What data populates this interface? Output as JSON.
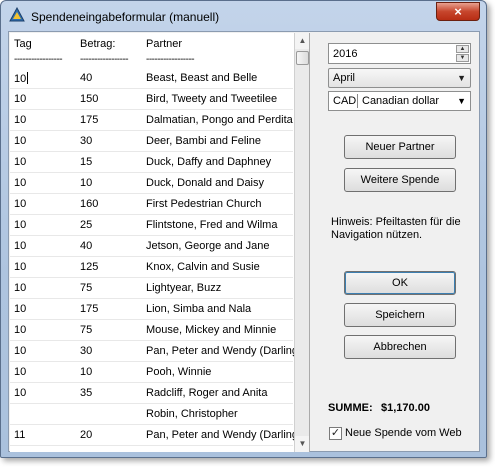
{
  "window": {
    "title": "Spendeneingabeformular (manuell)",
    "close_glyph": "×"
  },
  "list": {
    "columns": [
      "Tag",
      "Betrag:",
      "Partner"
    ],
    "dashes": [
      "-----------------",
      "-----------------",
      "-----------------"
    ],
    "rows": [
      {
        "tag": "10",
        "betrag": "40",
        "partner": "Beast, Beast and Belle"
      },
      {
        "tag": "10",
        "betrag": "150",
        "partner": "Bird, Tweety and Tweetilee"
      },
      {
        "tag": "10",
        "betrag": "175",
        "partner": "Dalmatian, Pongo and Perdita"
      },
      {
        "tag": "10",
        "betrag": "30",
        "partner": "Deer, Bambi and Feline"
      },
      {
        "tag": "10",
        "betrag": "15",
        "partner": "Duck, Daffy and Daphney"
      },
      {
        "tag": "10",
        "betrag": "10",
        "partner": "Duck, Donald and Daisy"
      },
      {
        "tag": "10",
        "betrag": "160",
        "partner": "First Pedestrian Church"
      },
      {
        "tag": "10",
        "betrag": "25",
        "partner": "Flintstone, Fred and Wilma"
      },
      {
        "tag": "10",
        "betrag": "40",
        "partner": "Jetson, George and Jane"
      },
      {
        "tag": "10",
        "betrag": "125",
        "partner": "Knox, Calvin and Susie"
      },
      {
        "tag": "10",
        "betrag": "75",
        "partner": "Lightyear, Buzz"
      },
      {
        "tag": "10",
        "betrag": "175",
        "partner": "Lion, Simba and Nala"
      },
      {
        "tag": "10",
        "betrag": "75",
        "partner": "Mouse, Mickey and Minnie"
      },
      {
        "tag": "10",
        "betrag": "30",
        "partner": "Pan, Peter and Wendy (Darling)"
      },
      {
        "tag": "10",
        "betrag": "10",
        "partner": "Pooh, Winnie"
      },
      {
        "tag": "10",
        "betrag": "35",
        "partner": "Radcliff, Roger and Anita"
      },
      {
        "tag": "",
        "betrag": "",
        "partner": "Robin, Christopher"
      },
      {
        "tag": "11",
        "betrag": "20",
        "partner": "Pan, Peter and Wendy (Darling)"
      }
    ]
  },
  "year": "2016",
  "month": "April",
  "currency": {
    "code": "CAD",
    "name": "Canadian dollar"
  },
  "buttons": {
    "new_partner": "Neuer Partner",
    "more_donation": "Weitere Spende",
    "ok": "OK",
    "save": "Speichern",
    "cancel": "Abbrechen"
  },
  "hint": "Hinweis: Pfeiltasten für die Navigation nützen.",
  "sum": {
    "label": "SUMME:",
    "value": "$1,170.00"
  },
  "web_checkbox": {
    "label": "Neue Spende vom Web",
    "checked": true
  }
}
